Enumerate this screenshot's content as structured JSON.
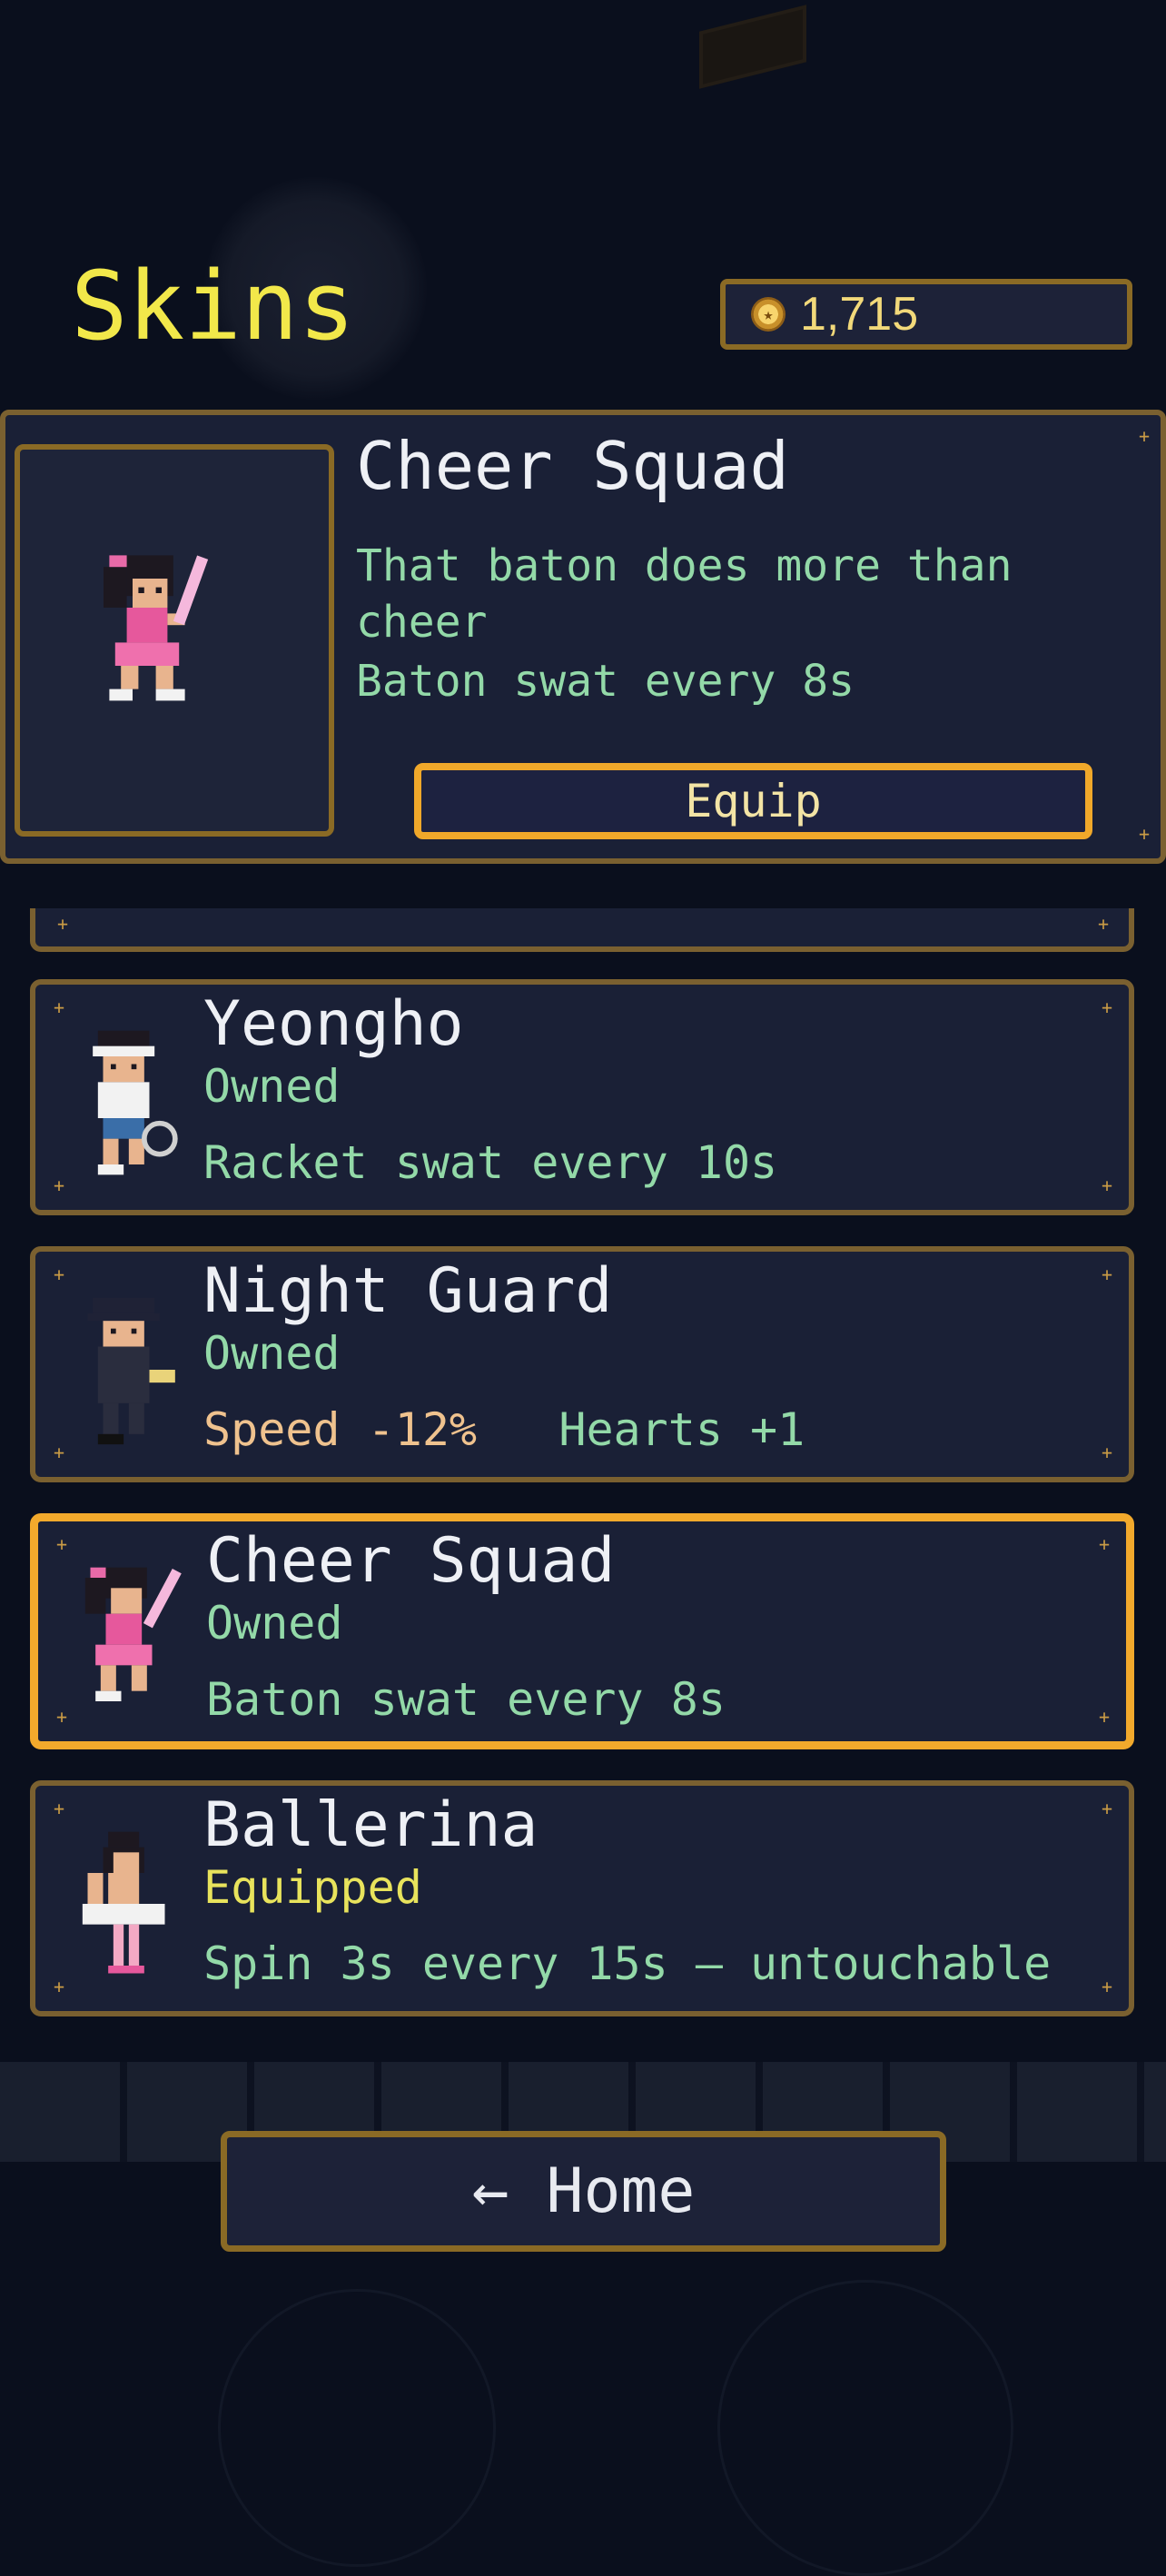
{
  "title": "Skins",
  "coins": {
    "value": "1,715",
    "icon": "coin-icon"
  },
  "detail": {
    "name": "Cheer Squad",
    "description": "That baton does more than cheer",
    "perk": "Baton swat every 8s",
    "action_label": "Equip"
  },
  "skins": [
    {
      "name": "Yeongho",
      "status": "Owned",
      "perk": "Racket swat every 10s"
    },
    {
      "name": "Night Guard",
      "status": "Owned",
      "perk_neg": "Speed -12%",
      "perk_pos": "Hearts +1"
    },
    {
      "name": "Cheer Squad",
      "status": "Owned",
      "perk": "Baton swat every 8s",
      "selected": true
    },
    {
      "name": "Ballerina",
      "status": "Equipped",
      "perk": "Spin 3s every 15s — untouchable"
    }
  ],
  "home_label": "← Home",
  "colors": {
    "accent": "#f2a92c",
    "title": "#f2e84a",
    "perk": "#93d9a8",
    "equipped": "#e8e35c",
    "frame": "#7a6030"
  }
}
